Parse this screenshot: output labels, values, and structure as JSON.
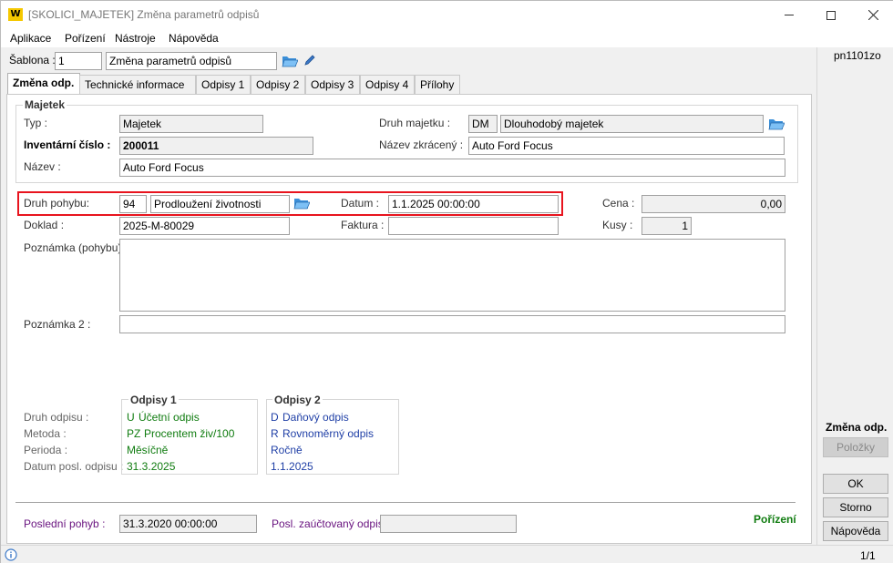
{
  "window": {
    "logo_text": "W",
    "title": "[SKOLICI_MAJETEK] Změna parametrů odpisů",
    "accent": "#f5c800"
  },
  "menu": [
    "Aplikace",
    "Pořízení",
    "Nástroje",
    "Nápověda"
  ],
  "sablona": {
    "label": "Šablona :",
    "number": "1",
    "name": "Změna parametrů odpisů"
  },
  "user_code": "pn1101zo",
  "tabs": [
    "Změna odp.",
    "Technické informace",
    "Odpisy 1",
    "Odpisy 2",
    "Odpisy 3",
    "Odpisy 4",
    "Přílohy"
  ],
  "majetek": {
    "title": "Majetek",
    "typ_label": "Typ :",
    "typ_value": "Majetek",
    "inv_label": "Inventární číslo :",
    "inv_value": "200011",
    "nazev_label": "Název :",
    "nazev_value": "Auto Ford Focus",
    "druh_label": "Druh majetku :",
    "druh_code": "DM",
    "druh_name": "Dlouhodobý majetek",
    "zkraceny_label": "Název zkrácený :",
    "zkraceny_value": "Auto Ford Focus"
  },
  "pohyb": {
    "druh_label": "Druh pohybu:",
    "druh_code": "94",
    "druh_name": "Prodloužení životnosti",
    "datum_label": "Datum :",
    "datum_value": "1.1.2025 00:00:00",
    "cena_label": "Cena :",
    "cena_value": "0,00",
    "doklad_label": "Doklad :",
    "doklad_value": "2025-M-80029",
    "faktura_label": "Faktura :",
    "faktura_value": "",
    "kusy_label": "Kusy :",
    "kusy_value": "1",
    "poznamka_label": "Poznámka (pohybu) :",
    "poznamka2_label": "Poznámka 2 :",
    "highlight_color": "#e8141e"
  },
  "odpisy_labels": {
    "druh": "Druh odpisu :",
    "metoda": "Metoda :",
    "perioda": "Perioda :",
    "datum": "Datum posl. odpisu :"
  },
  "odpisy1": {
    "title": "Odpisy 1",
    "druh_code": "U",
    "druh": "Účetní odpis",
    "metoda_code": "PZ",
    "metoda": "Procentem živ/100",
    "perioda": "Měsíčně",
    "datum": "31.3.2025"
  },
  "odpisy2": {
    "title": "Odpisy 2",
    "druh_code": "D",
    "druh": "Daňový odpis",
    "metoda_code": "R",
    "metoda": "Rovnoměrný odpis",
    "perioda": "Ročně",
    "datum": "1.1.2025"
  },
  "footer": {
    "posledni_label": "Poslední pohyb :",
    "posledni_value": "31.3.2020 00:00:00",
    "zauct_label": "Posl. zaúčtovaný odpis :",
    "zauct_value": "",
    "status": "Pořízení"
  },
  "side": {
    "title": "Změna odp.",
    "polozky": "Položky",
    "ok": "OK",
    "storno": "Storno",
    "napoveda": "Nápověda"
  },
  "statusbar": {
    "page": "1/1"
  }
}
